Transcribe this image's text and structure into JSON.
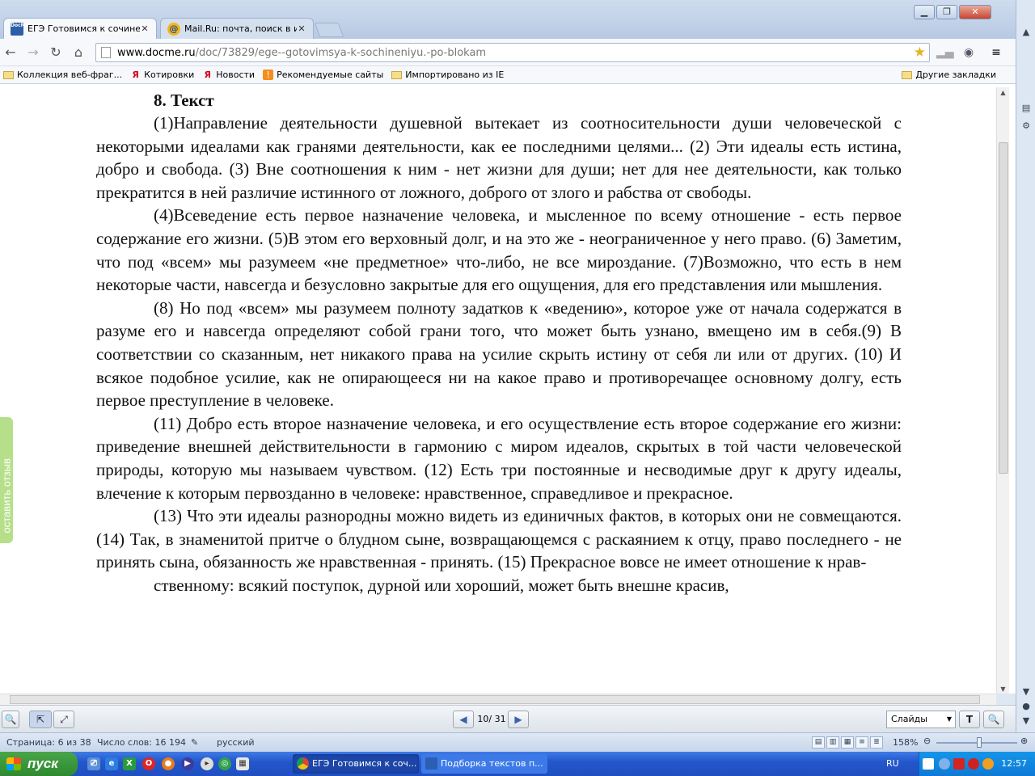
{
  "browser": {
    "tabs": [
      {
        "title": "ЕГЭ Готовимся к сочинени",
        "favicon": "DocMe"
      },
      {
        "title": "Mail.Ru: почта, поиск в инт",
        "favicon": "@"
      }
    ],
    "url_host": "www.docme.ru",
    "url_path": "/doc/73829/ege--gotovimsya-k-sochineniyu.-po-blokam",
    "bookmarks": [
      {
        "label": "Коллекция веб-фраг...",
        "icon": "folder-icon"
      },
      {
        "label": "Котировки",
        "icon": "yandex-icon"
      },
      {
        "label": "Новости",
        "icon": "yandex-icon"
      },
      {
        "label": "Рекомендуемые сайты",
        "icon": "recommended-icon"
      },
      {
        "label": "Импортировано из IE",
        "icon": "folder-icon"
      }
    ],
    "other_bookmarks": "Другие закладки"
  },
  "document": {
    "heading": "8. Текст",
    "paragraphs": [
      "(1)Направление деятельности душевной вытекает из соотносительности души человеческой с некоторыми идеалами как гранями деятельности, как ее последними целями... (2) Эти идеалы есть истина, добро и свобода. (3) Вне соотношения к ним - нет жизни для души; нет для нее деятельности, как только прекратится в ней различие истинного от ложного, доброго от злого и рабства от свободы.",
      "(4)Всеведение есть первое назначение человека, и мысленное по всему отношение - есть первое содержание его жизни. (5)В этом его верховный долг, и на это же - неограниченное у него право. (6) Заметим, что под «всем» мы разумеем «не предметное» что-либо, не все мироздание. (7)Возможно, что есть в нем некоторые части, навсегда и безусловно закрытые для его ощущения, для его представления или мышления.",
      "(8) Но под «всем» мы разумеем полноту задатков к «ведению», которое уже от начала содержатся в разуме его и навсегда определяют собой грани того, что может быть узнано, вмещено им в себя.(9) В соответствии со сказанным, нет никакого права на усилие скрыть истину от себя ли или от других. (10) И всякое подобное усилие, как не опирающееся ни на какое право и противоречащее основному долгу, есть первое преступление в человеке.",
      "(11) Добро есть второе назначение человека, и его осуществление есть второе содержание его жизни: приведение внешней действительности в гармонию с миром идеалов, скрытых в той части человеческой природы, которую мы называем чувством. (12) Есть три постоянные и несводимые друг к другу идеалы, влечение к которым первозданно в человеке: нравственное, справедливое и прекрасное.",
      "(13) Что эти идеалы разнородны можно видеть из единичных фактов, в которых они не совмещаются.(14) Так, в знаменитой притче о блудном сыне, возвращающемся с раскаянием к отцу, право последнего - не принять сына, обязанность же нравственная - принять. (15) Прекрасное вовсе не имеет отношение к нрав-",
      "ственному: всякий поступок, дурной или хороший, может быть внешне красив,"
    ],
    "feedback_tab": "оставить отзыв"
  },
  "viewer": {
    "page_indicator": "10/ 31",
    "mode": "Слайды"
  },
  "word_status": {
    "page": "Страница: 6 из 38",
    "words": "Число слов: 16 194",
    "language": "русский",
    "zoom": "158%"
  },
  "taskbar": {
    "start_label": "пуск",
    "tasks": [
      "ЕГЭ Готовимся к соч...",
      "Подборка текстов п..."
    ],
    "lang": "RU",
    "clock": "12:57"
  }
}
